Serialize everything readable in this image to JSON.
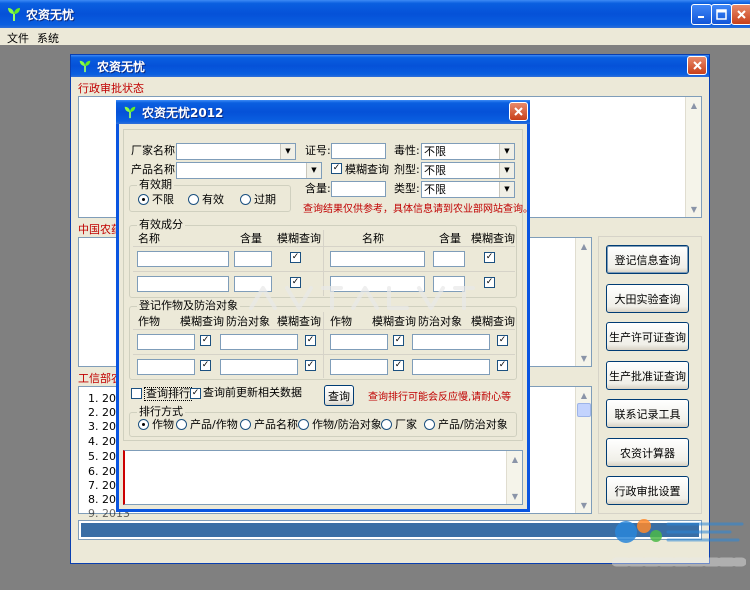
{
  "app": {
    "title": "农资无忧",
    "menu": [
      "文件",
      "系统"
    ]
  },
  "inner_window": {
    "title": "农资无忧",
    "admin_status_label": "行政审批状态",
    "china_agri_label": "中国农药",
    "miit_label": "工信部农",
    "list_items": [
      "1. 2013",
      "2. 2013",
      "3. 2013",
      "4. 2013",
      "5. 2013",
      "6. 2013",
      "7. 2013",
      "8. 2013",
      "9. 2013"
    ],
    "side_buttons": [
      "登记信息查询",
      "大田实验查询",
      "生产许可证查询",
      "生产批准证查询",
      "联系记录工具",
      "农资计算器",
      "行政审批设置"
    ]
  },
  "dialog": {
    "title": "农资无忧2012",
    "manufacturer_label": "厂家名称:",
    "product_label": "产品名称:",
    "cert_label": "证号:",
    "toxicity_label": "毒性:",
    "toxicity_value": "不限",
    "fuzzy_label": "模糊查询",
    "form_label": "剂型:",
    "form_value": "不限",
    "content_label": "含量:",
    "type_label": "类型:",
    "type_value": "不限",
    "validity_group": "有效期",
    "validity_options": [
      "不限",
      "有效",
      "过期"
    ],
    "notice": "查询结果仅供参考，具体信息请到农业部网站查询。",
    "ingredients_group": "有效成分",
    "ing_headers": [
      "名称",
      "含量",
      "模糊查询",
      "名称",
      "含量",
      "模糊查询"
    ],
    "crops_group": "登记作物及防治对象",
    "crop_headers": [
      "作物",
      "模糊查询",
      "防治对象",
      "模糊查询",
      "作物",
      "模糊查询",
      "防治对象",
      "模糊查询"
    ],
    "rank_label": "查询排行",
    "refresh_label": "查询前更新相关数据",
    "query_button": "查询",
    "rank_notice": "查询排行可能会反应慢,请耐心等",
    "sort_group": "排行方式",
    "sort_options": [
      "作物",
      "产品/作物",
      "产品名称",
      "作物/防治对象",
      "厂家",
      "产品/防治对象"
    ]
  },
  "watermark": {
    "center": "www.DuoTe.com",
    "brand": "2345软件大全",
    "brand_url": "www.DuoTe.com",
    "slogan": "国内最安全的软件站"
  },
  "colors": {
    "title_blue": "#0551d8",
    "window_bg": "#ece9d8",
    "notice_red": "#c00000",
    "progress_blue": "#3a6ea5"
  }
}
